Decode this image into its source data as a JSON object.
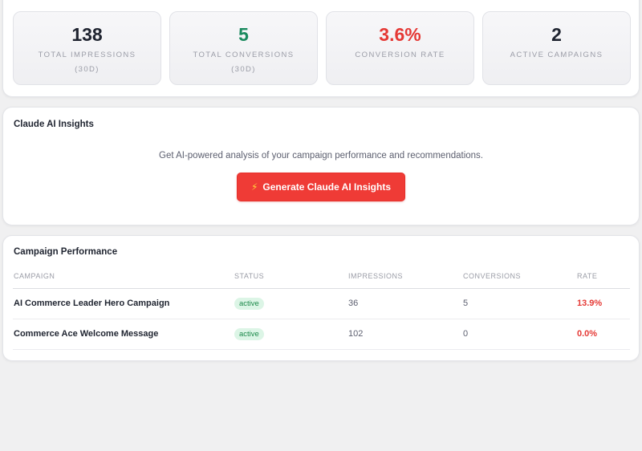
{
  "colors": {
    "success": "#1a8a5e",
    "danger": "#e53935",
    "accent_button": "#ef3b36",
    "badge_bg": "#dcf5e6"
  },
  "stats": [
    {
      "value": "138",
      "label_line1": "TOTAL IMPRESSIONS",
      "label_line2": "(30D)",
      "color": "#1f2430"
    },
    {
      "value": "5",
      "label_line1": "TOTAL CONVERSIONS",
      "label_line2": "(30D)",
      "color": "#1a8a5e"
    },
    {
      "value": "3.6%",
      "label_line1": "CONVERSION RATE",
      "label_line2": "",
      "color": "#e53935"
    },
    {
      "value": "2",
      "label_line1": "ACTIVE CAMPAIGNS",
      "label_line2": "",
      "color": "#1f2430"
    }
  ],
  "insights": {
    "title": "Claude AI Insights",
    "description": "Get AI-powered analysis of your campaign performance and recommendations.",
    "button_icon": "lightning-icon",
    "button_label": "Generate Claude AI Insights"
  },
  "performance": {
    "title": "Campaign Performance",
    "columns": [
      "CAMPAIGN",
      "STATUS",
      "IMPRESSIONS",
      "CONVERSIONS",
      "RATE"
    ],
    "rows": [
      {
        "campaign": "AI Commerce Leader Hero Campaign",
        "status": "active",
        "impressions": "36",
        "conversions": "5",
        "rate": "13.9%"
      },
      {
        "campaign": "Commerce Ace Welcome Message",
        "status": "active",
        "impressions": "102",
        "conversions": "0",
        "rate": "0.0%"
      }
    ]
  }
}
